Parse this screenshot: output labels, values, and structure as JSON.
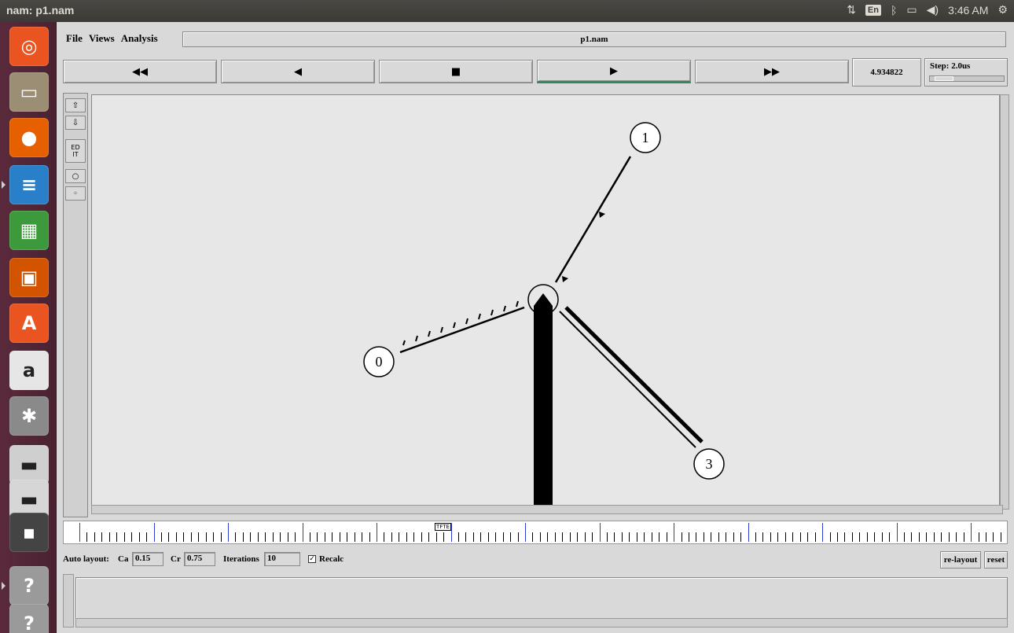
{
  "window": {
    "title": "nam: p1.nam"
  },
  "tray": {
    "language": "En",
    "clock": "3:46 AM"
  },
  "launcher": {
    "items": [
      {
        "name": "ubuntu-dash-icon",
        "glyph": "◎",
        "color": "#e95420"
      },
      {
        "name": "files-icon",
        "glyph": "▭",
        "color": "#9c8e74"
      },
      {
        "name": "firefox-icon",
        "glyph": "●",
        "color": "#e66000"
      },
      {
        "name": "writer-icon",
        "glyph": "≡",
        "color": "#2a7fc9"
      },
      {
        "name": "calc-icon",
        "glyph": "▦",
        "color": "#3c9a3c"
      },
      {
        "name": "impress-icon",
        "glyph": "▣",
        "color": "#d35400"
      },
      {
        "name": "software-center-icon",
        "glyph": "A",
        "color": "#e95420"
      },
      {
        "name": "amazon-icon",
        "glyph": "a",
        "color": "#e6e6e6"
      },
      {
        "name": "system-settings-icon",
        "glyph": "✱",
        "color": "#8a8a8a"
      },
      {
        "name": "drive-icon",
        "glyph": "▬",
        "color": "#cfcfcf"
      },
      {
        "name": "drive-stack-icon",
        "glyph": "▬",
        "color": "#d6d6d6"
      },
      {
        "name": "terminal-icon",
        "glyph": "▪",
        "color": "#444444"
      },
      {
        "name": "unknown-app-icon",
        "glyph": "?",
        "color": "#9a9a9a"
      },
      {
        "name": "unknown-app-2-icon",
        "glyph": "?",
        "color": "#9a9a9a"
      }
    ]
  },
  "menubar": {
    "file": "File",
    "views": "Views",
    "analysis": "Analysis",
    "filename": "p1.nam"
  },
  "controls": {
    "rewind": "◀◀",
    "back": "◀",
    "stop": "■",
    "play": "▶",
    "fast_forward": "▶▶",
    "time": "4.934822",
    "step_label": "Step: 2.0us"
  },
  "tools": {
    "edit": "ED\nIT"
  },
  "network": {
    "nodes": [
      {
        "id": "0",
        "label": "0"
      },
      {
        "id": "1",
        "label": "1"
      },
      {
        "id": "2",
        "label": ""
      },
      {
        "id": "3",
        "label": "3"
      }
    ],
    "links": [
      {
        "from": "0",
        "to": "2"
      },
      {
        "from": "1",
        "to": "2"
      },
      {
        "from": "2",
        "to": "3"
      }
    ]
  },
  "timeline": {
    "marker": "TFTE"
  },
  "autolayout": {
    "label": "Auto layout:",
    "ca_label": "Ca",
    "ca_value": "0.15",
    "cr_label": "Cr",
    "cr_value": "0.75",
    "iterations_label": "Iterations",
    "iterations_value": "10",
    "recalc_label": "Recalc",
    "relayout": "re-layout",
    "reset": "reset"
  }
}
